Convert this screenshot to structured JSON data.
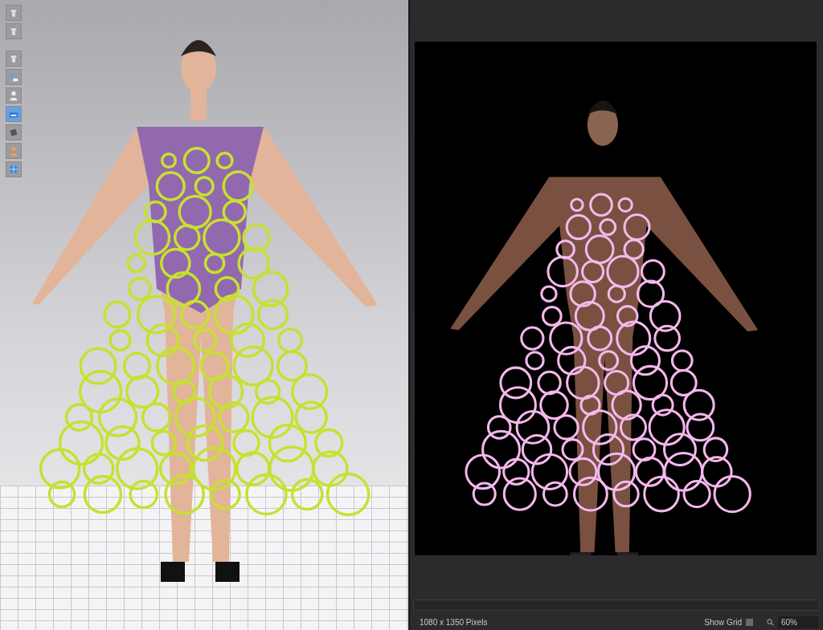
{
  "status_bar": {
    "image_size": "1080 x 1350 Pixels",
    "show_grid": {
      "label": "Show Grid",
      "checked": false
    },
    "zoom": "60%"
  }
}
